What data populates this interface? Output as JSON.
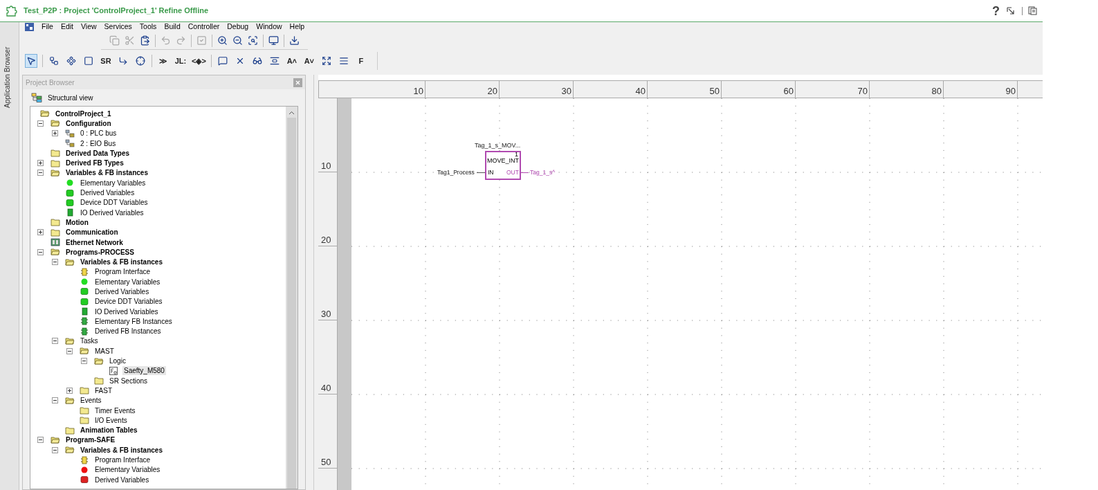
{
  "window": {
    "title": "Test_P2P : Project 'ControlProject_1' Refine Offline",
    "help_symbol": "?"
  },
  "side_tab": {
    "label": "Application Browser"
  },
  "menu": [
    "File",
    "Edit",
    "View",
    "Services",
    "Tools",
    "Build",
    "Controller",
    "Debug",
    "Window",
    "Help"
  ],
  "toolbar_1": [
    {
      "kind": "copy",
      "disabled": true
    },
    {
      "kind": "cut",
      "disabled": true
    },
    {
      "kind": "paste",
      "disabled": false
    },
    {
      "kind": "sep"
    },
    {
      "kind": "undo",
      "disabled": true
    },
    {
      "kind": "redo",
      "disabled": true
    },
    {
      "kind": "sep"
    },
    {
      "kind": "check",
      "disabled": true
    },
    {
      "kind": "sep"
    },
    {
      "kind": "zoom-in",
      "disabled": false
    },
    {
      "kind": "zoom-out",
      "disabled": false
    },
    {
      "kind": "zoom-fit",
      "disabled": false
    },
    {
      "kind": "sep"
    },
    {
      "kind": "monitor",
      "disabled": false
    },
    {
      "kind": "sep"
    },
    {
      "kind": "export",
      "disabled": false
    }
  ],
  "toolbar_2": [
    {
      "kind": "pointer",
      "selected": true
    },
    {
      "kind": "sep"
    },
    {
      "kind": "connect",
      "selected": false
    },
    {
      "kind": "function",
      "selected": false
    },
    {
      "kind": "block",
      "selected": false
    },
    {
      "kind": "text",
      "label": "SR",
      "selected": false
    },
    {
      "kind": "jump",
      "selected": false
    },
    {
      "kind": "coil",
      "selected": false
    },
    {
      "kind": "sep"
    },
    {
      "kind": "text",
      "label": "≫",
      "selected": false
    },
    {
      "kind": "text",
      "label": "JL:",
      "selected": false
    },
    {
      "kind": "text",
      "label": "<◈>",
      "selected": false
    },
    {
      "kind": "sep"
    },
    {
      "kind": "comment",
      "selected": false
    },
    {
      "kind": "delete",
      "selected": false
    },
    {
      "kind": "glasses",
      "selected": false
    },
    {
      "kind": "align",
      "selected": false
    },
    {
      "kind": "text",
      "label": "A˄",
      "selected": false
    },
    {
      "kind": "text",
      "label": "A˅",
      "selected": false
    },
    {
      "kind": "resize",
      "selected": false
    },
    {
      "kind": "bars",
      "selected": false
    },
    {
      "kind": "text",
      "label": "F",
      "selected": false
    }
  ],
  "project_browser": {
    "title": "Project Browser",
    "view": "Structural view",
    "tree": [
      {
        "label": "ControlProject_1",
        "kind": "folder-open",
        "bold": true,
        "selected": false,
        "children": [
          {
            "label": "Configuration",
            "kind": "folder-open",
            "bold": true,
            "expanded": true,
            "selected": false,
            "children": [
              {
                "label": "0 : PLC bus",
                "kind": "bus",
                "bold": false,
                "expanded": false,
                "selected": false
              },
              {
                "label": "2 : EIO Bus",
                "kind": "bus",
                "bold": false,
                "selected": false
              }
            ]
          },
          {
            "label": "Derived Data Types",
            "kind": "folder",
            "bold": true,
            "selected": false
          },
          {
            "label": "Derived FB Types",
            "kind": "folder",
            "bold": true,
            "expanded": false,
            "selected": false
          },
          {
            "label": "Variables & FB instances",
            "kind": "folder-open",
            "bold": true,
            "expanded": true,
            "selected": false,
            "children": [
              {
                "label": "Elementary Variables",
                "kind": "green-dot",
                "bold": false,
                "selected": false
              },
              {
                "label": "Derived Variables",
                "kind": "green-block",
                "bold": false,
                "selected": false
              },
              {
                "label": "Device DDT Variables",
                "kind": "green-block",
                "bold": false,
                "selected": false
              },
              {
                "label": "IO Derived Variables",
                "kind": "green-square",
                "bold": false,
                "selected": false
              }
            ]
          },
          {
            "label": "Motion",
            "kind": "folder",
            "bold": true,
            "selected": false
          },
          {
            "label": "Communication",
            "kind": "folder",
            "bold": true,
            "expanded": false,
            "selected": false
          },
          {
            "label": "Ethernet Network",
            "kind": "network",
            "bold": true,
            "selected": false
          },
          {
            "label": "Programs-PROCESS",
            "kind": "folder-open",
            "bold": true,
            "expanded": true,
            "selected": false,
            "children": [
              {
                "label": "Variables & FB instances",
                "kind": "folder-open",
                "bold": true,
                "expanded": true,
                "selected": false,
                "children": [
                  {
                    "label": "Program Interface",
                    "kind": "interface",
                    "bold": false,
                    "selected": false
                  },
                  {
                    "label": "Elementary Variables",
                    "kind": "green-dot",
                    "bold": false,
                    "selected": false
                  },
                  {
                    "label": "Derived Variables",
                    "kind": "green-block",
                    "bold": false,
                    "selected": false
                  },
                  {
                    "label": "Device DDT Variables",
                    "kind": "green-block",
                    "bold": false,
                    "selected": false
                  },
                  {
                    "label": "IO Derived Variables",
                    "kind": "green-square",
                    "bold": false,
                    "selected": false
                  },
                  {
                    "label": "Elementary FB Instances",
                    "kind": "fb",
                    "bold": false,
                    "selected": false
                  },
                  {
                    "label": "Derived FB Instances",
                    "kind": "fb",
                    "bold": false,
                    "selected": false
                  }
                ]
              },
              {
                "label": "Tasks",
                "kind": "folder-open",
                "bold": false,
                "expanded": true,
                "selected": false,
                "children": [
                  {
                    "label": "MAST",
                    "kind": "folder-open",
                    "bold": false,
                    "expanded": true,
                    "selected": false,
                    "children": [
                      {
                        "label": "Logic",
                        "kind": "folder-open",
                        "bold": false,
                        "expanded": true,
                        "selected": false,
                        "children": [
                          {
                            "label": "Saefty_M580",
                            "kind": "section",
                            "bold": false,
                            "selected": true
                          }
                        ]
                      },
                      {
                        "label": "SR Sections",
                        "kind": "folder",
                        "bold": false,
                        "selected": false
                      }
                    ]
                  },
                  {
                    "label": "FAST",
                    "kind": "folder",
                    "bold": false,
                    "expanded": false,
                    "selected": false
                  }
                ]
              },
              {
                "label": "Events",
                "kind": "folder-open",
                "bold": false,
                "expanded": true,
                "selected": false,
                "children": [
                  {
                    "label": "Timer Events",
                    "kind": "folder",
                    "bold": false,
                    "selected": false
                  },
                  {
                    "label": "I/O Events",
                    "kind": "folder",
                    "bold": false,
                    "selected": false
                  }
                ]
              },
              {
                "label": "Animation Tables",
                "kind": "folder",
                "bold": true,
                "selected": false
              }
            ]
          },
          {
            "label": "Program-SAFE",
            "kind": "folder-open",
            "bold": true,
            "expanded": true,
            "selected": false,
            "children": [
              {
                "label": "Variables & FB instances",
                "kind": "folder-open",
                "bold": true,
                "expanded": true,
                "selected": false,
                "children": [
                  {
                    "label": "Program Interface",
                    "kind": "interface",
                    "bold": false,
                    "selected": false
                  },
                  {
                    "label": "Elementary Variables",
                    "kind": "red-dot",
                    "bold": false,
                    "selected": false
                  },
                  {
                    "label": "Derived Variables",
                    "kind": "red-block",
                    "bold": false,
                    "selected": false
                  }
                ]
              }
            ]
          }
        ]
      }
    ]
  },
  "editor": {
    "column_ruler": [
      "10",
      "20",
      "30",
      "40",
      "50",
      "60",
      "70",
      "80",
      "90"
    ],
    "row_ruler": [
      "10",
      "20",
      "30",
      "40",
      "50"
    ],
    "block": {
      "instance": "Tag_1_s_MOV...",
      "number": "1",
      "type": "MOVE_INT",
      "input_pin": "IN",
      "output_pin": "OUT",
      "input_var": "Tag1_Process",
      "output_var": "Tag_1_s^"
    }
  }
}
